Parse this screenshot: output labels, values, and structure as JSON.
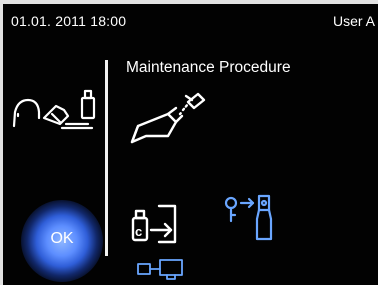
{
  "status_bar": {
    "datetime": "01.01. 2011 18:00",
    "user": "User A"
  },
  "main": {
    "title": "Maintenance Procedure"
  },
  "icons": {
    "left_device": "handpiece-maintenance-icon",
    "handpiece_spray": "handpiece-spray-icon",
    "insert_cartridge": "insert-cartridge-icon",
    "key_to_bottle": "key-to-bottle-icon",
    "pc_connection": "pc-connection-icon"
  },
  "ok_button": {
    "label": "OK"
  },
  "colors": {
    "background": "#020202",
    "accent_blue": "#6aa6ff",
    "text": "#ffffff"
  }
}
